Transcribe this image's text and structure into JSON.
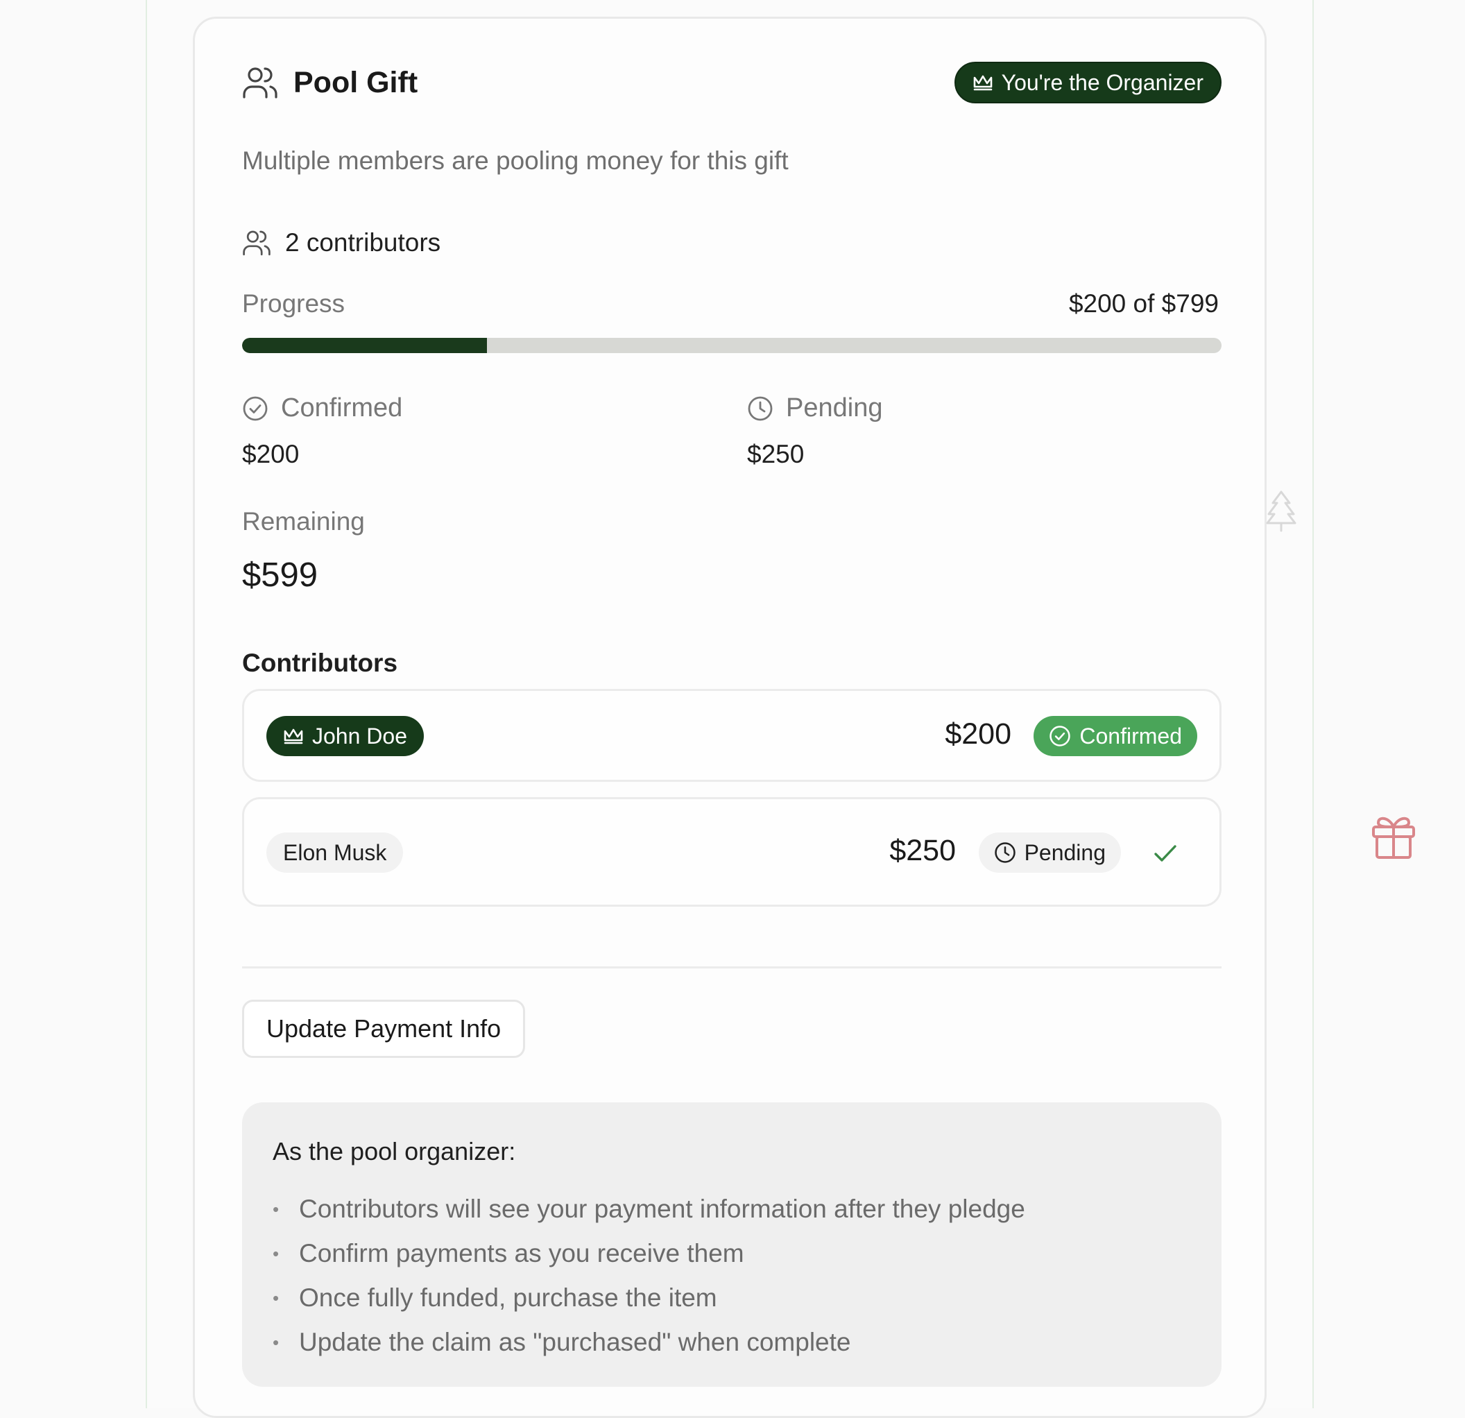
{
  "header": {
    "title": "Pool Gift",
    "organizer_badge": "You're the Organizer",
    "subtitle": "Multiple members are pooling money for this gift"
  },
  "contributors_count_label": "2 contributors",
  "progress": {
    "label": "Progress",
    "amount_text": "$200 of $799",
    "fraction": 0.25
  },
  "stats": {
    "confirmed": {
      "label": "Confirmed",
      "value": "$200"
    },
    "pending": {
      "label": "Pending",
      "value": "$250"
    },
    "remaining": {
      "label": "Remaining",
      "value": "$599"
    }
  },
  "contributors": {
    "title": "Contributors",
    "rows": [
      {
        "name": "John Doe",
        "amount": "$200",
        "status": "Confirmed",
        "is_organizer": true
      },
      {
        "name": "Elon Musk",
        "amount": "$250",
        "status": "Pending",
        "is_organizer": false
      }
    ]
  },
  "actions": {
    "update_payment_label": "Update Payment Info"
  },
  "info": {
    "title": "As the pool organizer:",
    "items": [
      "Contributors will see your payment information after they pledge",
      "Confirm payments as you receive them",
      "Once fully funded, purchase the item",
      "Update the claim as \"purchased\" when complete"
    ]
  },
  "colors": {
    "primary_dark_green": "#163a1a",
    "confirmed_green": "#4aa559",
    "progress_track": "#d7d8d4",
    "decor_pink": "#d9868a"
  },
  "icons": {
    "header": "users-icon",
    "organizer": "crown-icon",
    "confirmed": "check-circle-icon",
    "pending": "clock-icon",
    "row_action": "check-icon",
    "decor": [
      "tree-icon",
      "gift-icon"
    ]
  }
}
